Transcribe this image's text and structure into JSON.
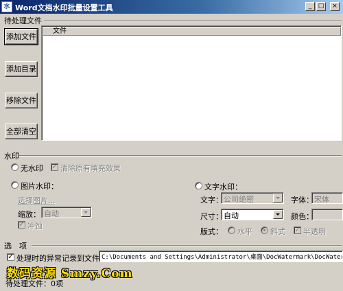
{
  "window": {
    "title": "Word文档水印批量设置工具",
    "icon_name": "app-icon",
    "icon_text": "水",
    "minimize_glyph": "_",
    "maximize_glyph": "□",
    "close_glyph": "×"
  },
  "pending_group": {
    "label": "待处理文件",
    "buttons": {
      "add_file": "添加文件",
      "add_dir": "添加目录",
      "remove_file": "移除文件",
      "clear_all": "全部清空"
    },
    "list_column": "文件"
  },
  "watermark_group": {
    "label": "水印",
    "no_watermark": {
      "label": "无水印",
      "selected": false
    },
    "clear_fill": {
      "label": "清除原有填充效果",
      "checked": true,
      "enabled": false
    },
    "image_watermark": {
      "label": "图片水印：",
      "selected": false,
      "choose_image": "选择图片...",
      "scale_label": "缩放：",
      "scale_value": "自动",
      "washout_label": "冲蚀",
      "washout_checked": true
    },
    "text_watermark": {
      "label": "文字水印：",
      "selected": false,
      "text_label": "文字：",
      "text_value": "公司绝密",
      "font_label": "字体：",
      "font_value": "宋体",
      "size_label": "尺寸：",
      "size_value": "自动",
      "color_label": "颜色：",
      "color_value": "",
      "layout_label": "版式：",
      "layout_horizontal": "水平",
      "layout_diagonal": "斜式",
      "layout_diagonal_selected": true,
      "semi_transparent_label": "半透明",
      "semi_transparent_checked": true
    }
  },
  "options_group": {
    "label": "选　项",
    "log_errors_label": "处理时的异常记录到文件：",
    "log_errors_checked": true,
    "log_path": "C:\\Documents and Settings\\Administrator\\桌面\\DocWatermark\\DocWatermark\\Log"
  },
  "overlay": {
    "site_watermark": "数码资源 Smzy.Com"
  },
  "status": {
    "partial": "待",
    "pending_count": "待处理文件：0项"
  }
}
